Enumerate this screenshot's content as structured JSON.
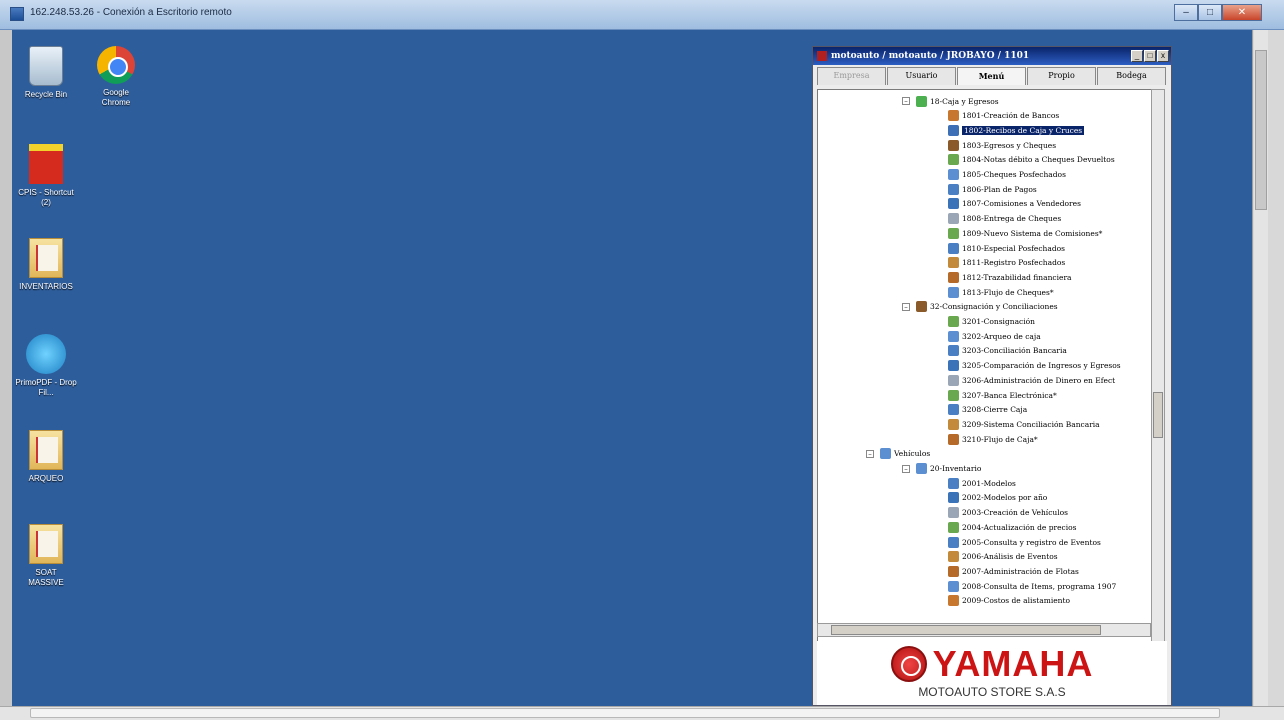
{
  "rdp": {
    "title": "162.248.53.26 - Conexión a Escritorio remoto",
    "minimize": "–",
    "maximize": "□",
    "close": "✕"
  },
  "desktop_icons": [
    {
      "label": "Recycle Bin",
      "icon": "recycle-bin-icon"
    },
    {
      "label": "Google Chrome",
      "icon": "chrome-icon"
    },
    {
      "label": "CPIS - Shortcut (2)",
      "icon": "cpis-shortcut-icon"
    },
    {
      "label": "INVENTARIOS",
      "icon": "folder-pdf-icon"
    },
    {
      "label": "PrimoPDF - Drop Fil...",
      "icon": "primopdf-icon"
    },
    {
      "label": "ARQUEO",
      "icon": "folder-pdf-icon"
    },
    {
      "label": "SOAT MASSIVE",
      "icon": "folder-pdf-icon"
    }
  ],
  "app": {
    "title": "motoauto / motoauto / JROBAYO / 1101",
    "tabs": [
      "Empresa",
      "Usuario",
      "Menú",
      "Propio",
      "Bodega"
    ],
    "active_tab": "Menú",
    "tree": {
      "group_caja": "18-Caja y Egresos",
      "caja_items": [
        "1801-Creación de Bancos",
        "1802-Recibos de Caja y Cruces",
        "1803-Egresos y Cheques",
        "1804-Notas débito a Cheques Devueltos",
        "1805-Cheques Posfechados",
        "1806-Plan de Pagos",
        "1807-Comisiones a Vendedores",
        "1808-Entrega de Cheques",
        "1809-Nuevo Sistema de Comisiones*",
        "1810-Especial Posfechados",
        "1811-Registro Posfechados",
        "1812-Trazabilidad financiera",
        "1813-Flujo de Cheques*"
      ],
      "selected_item": "1802-Recibos de Caja y Cruces",
      "group_consig": "32-Consignación y Conciliaciones",
      "consig_items": [
        "3201-Consignación",
        "3202-Arqueo de caja",
        "3203-Conciliación Bancaria",
        "3205-Comparación de Ingresos y Egresos",
        "3206-Administración de Dinero en Efect",
        "3207-Banca Electrónica*",
        "3208-Cierre Caja",
        "3209-Sistema Conciliación Bancaria",
        "3210-Flujo de Caja*"
      ],
      "group_vehiculos": "Vehículos",
      "group_inventario": "20-Inventario",
      "inventario_items": [
        "2001-Modelos",
        "2002-Modelos por año",
        "2003-Creación de Vehículos",
        "2004-Actualización de precios",
        "2005-Consulta y registro de Eventos",
        "2006-Análisis de Eventos",
        "2007-Administración de Flotas",
        "2008-Consulta de Items, programa 1907",
        "2009-Costos de alistamiento"
      ]
    },
    "brand": {
      "name": "YAMAHA",
      "store": "MOTOAUTO STORE S.A.S"
    }
  }
}
